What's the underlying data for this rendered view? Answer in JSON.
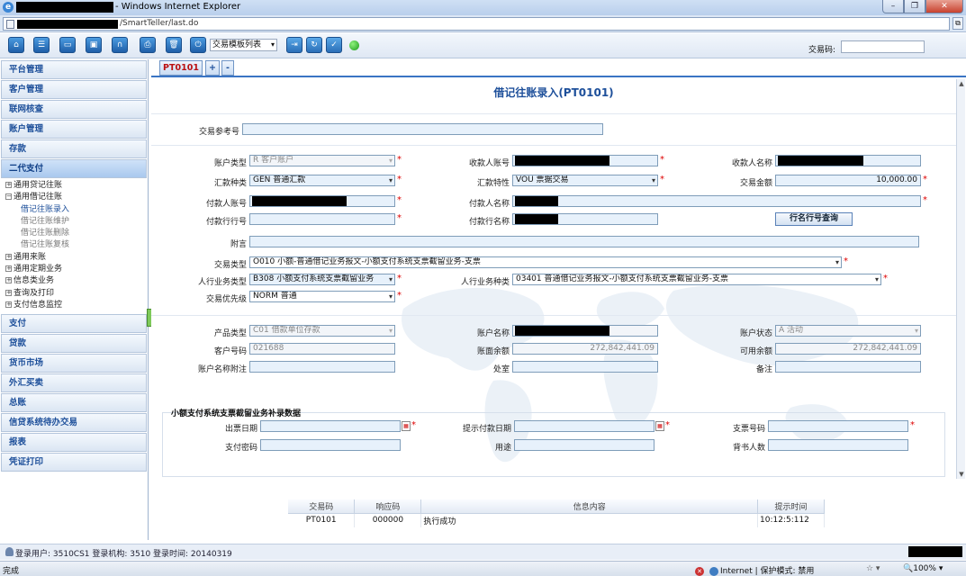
{
  "window": {
    "title_suffix": "- Windows Internet Explorer",
    "url": "/SmartTeller/last.do",
    "min": "–",
    "max": "❐",
    "close": "✕"
  },
  "toolbar": {
    "template_select": "交易模板列表",
    "trcode_label": "交易码:",
    "trcode_value": "",
    "buttons": [
      "home-icon",
      "list-icon",
      "save-icon",
      "doc-icon",
      "headset-icon",
      "print-icon",
      "trash-icon",
      "export-icon",
      "refresh-icon",
      "check-icon"
    ]
  },
  "sidebar": {
    "sections_top": [
      "平台管理",
      "客户管理",
      "联网核查",
      "账户管理",
      "存款",
      "二代支付"
    ],
    "tree": {
      "g1": "通用贷记往账",
      "g2": "通用借记往账",
      "leaves": [
        "借记往账录入",
        "借记往账维护",
        "借记往账删除",
        "借记往账复核"
      ],
      "more": [
        "通用来账",
        "通用定期业务",
        "信息类业务",
        "查询及打印",
        "支付信息监控"
      ]
    },
    "sections_bottom": [
      "支付",
      "贷款",
      "货币市场",
      "外汇买卖",
      "总账",
      "信贷系统待办交易",
      "报表",
      "凭证打印"
    ]
  },
  "tabs": {
    "active": "PT0101",
    "add": "+",
    "remove": "-"
  },
  "form": {
    "title": "借记往账录入(PT0101)",
    "ref_label": "交易参考号",
    "acct_type_label": "账户类型",
    "acct_type": "R 客户账户",
    "payee_acct_label": "收款人账号",
    "payee_name_label": "收款人名称",
    "remit_type_label": "汇款种类",
    "remit_type": "GEN 普通汇款",
    "remit_prop_label": "汇款特性",
    "remit_prop": "VOU 票据交易",
    "amount_label": "交易金额",
    "amount": "10,000.00",
    "payer_acct_label": "付款人账号",
    "payer_name_label": "付款人名称",
    "payer_bank_no_label": "付款行行号",
    "payer_bank_name_label": "付款行名称",
    "bank_query_button": "行名行号查询",
    "postscript_label": "附言",
    "tx_type_label": "交易类型",
    "tx_type": "O010 小额-普通借记业务报文-小额支付系统支票截留业务-支票",
    "biz_class_label": "人行业务类型",
    "biz_class": "B308 小额支付系统支票截留业务",
    "biz_kind_label": "人行业务种类",
    "biz_kind": "03401 普通借记业务报文-小额支付系统支票截留业务-支票",
    "priority_label": "交易优先级",
    "priority": "NORM 普通",
    "product_label": "产品类型",
    "product": "C01 借款单位存款",
    "acct_name_label": "账户名称",
    "acct_status_label": "账户状态",
    "acct_status": "A 活动",
    "cust_no_label": "客户号码",
    "cust_no": "021688",
    "book_bal_label": "账面余额",
    "book_bal": "272,842,441.09",
    "avail_bal_label": "可用余额",
    "avail_bal": "272,842,441.09",
    "acct_note_label": "账户名称附注",
    "office_label": "处室",
    "remark_label": "备注",
    "supp_title": "小额支付系统支票截留业务补录数据",
    "issue_date_label": "出票日期",
    "pay_date_label": "提示付款日期",
    "cheque_no_label": "支票号码",
    "pay_pwd_label": "支付密码",
    "usage_label": "用途",
    "endorse_label": "背书人数"
  },
  "messages": {
    "headers": [
      "交易码",
      "响应码",
      "信息内容",
      "提示时间"
    ],
    "rows": [
      {
        "code": "PT0101",
        "resp": "000000",
        "info": "执行成功",
        "time": "10:12:5:112"
      }
    ]
  },
  "status": {
    "login": "登录用户: 3510CS1 登录机构: 3510 登录时间: 20140319"
  },
  "iestatus": {
    "done": "完成",
    "zone": "Internet | 保护模式: 禁用",
    "zoom": "100%"
  },
  "colors": {
    "accent": "#1d4f9a",
    "required": "#dd0000",
    "field_bg": "#e7f1fb"
  }
}
